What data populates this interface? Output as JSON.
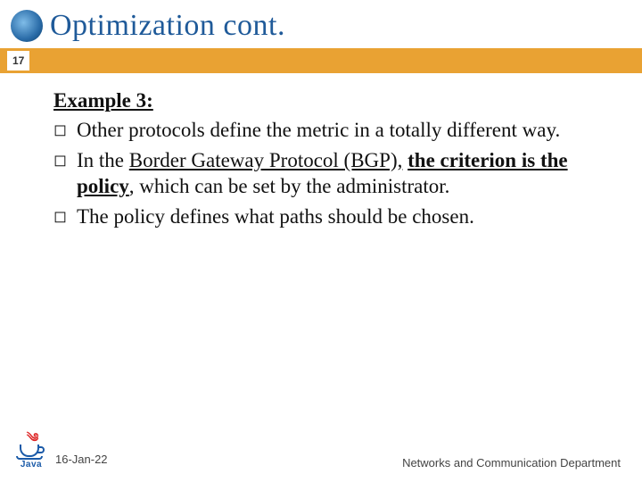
{
  "title": "Optimization cont.",
  "page_number": "17",
  "section_heading": "Example 3:",
  "bullets": [
    {
      "pre": "Other protocols define the metric in a totally different way.",
      "mid": "",
      "post": ""
    },
    {
      "pre": "In the ",
      "mid": "Border Gateway Protocol (BGP), the criterion is the policy",
      "post": ", which can be set by the administrator."
    },
    {
      "pre": "The policy defines what paths should be chosen.",
      "mid": "",
      "post": ""
    }
  ],
  "footer": {
    "date": "16-Jan-22",
    "department": "Networks and Communication Department",
    "logo_text": "Java"
  }
}
